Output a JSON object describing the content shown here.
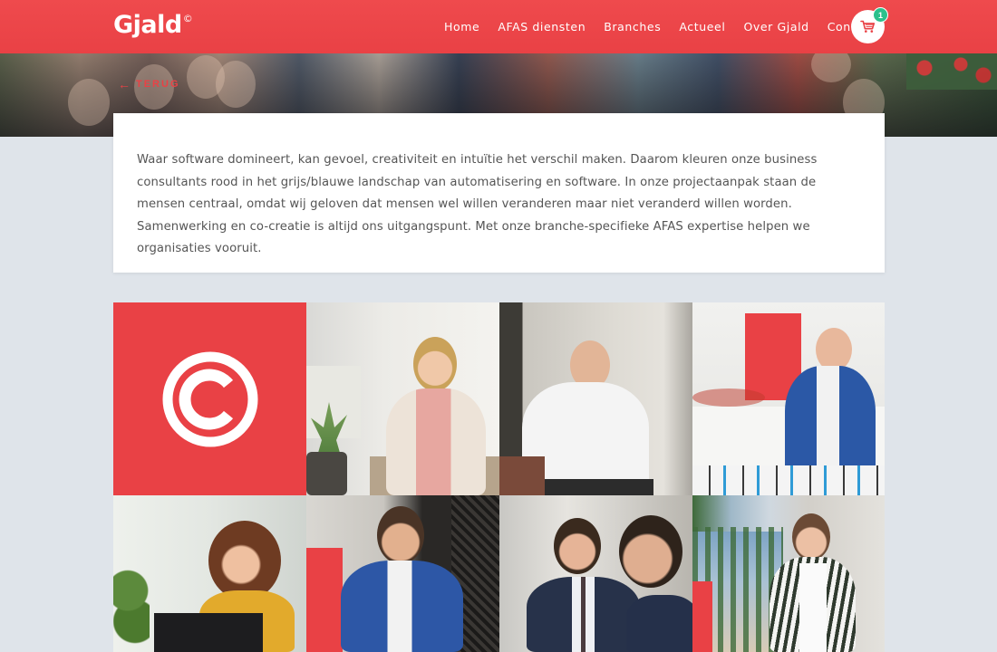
{
  "header": {
    "logo": "Gjald",
    "logo_mark": "©",
    "nav": [
      {
        "label": "Home"
      },
      {
        "label": "AFAS diensten"
      },
      {
        "label": "Branches"
      },
      {
        "label": "Actueel"
      },
      {
        "label": "Over Gjald"
      },
      {
        "label": "Contact"
      }
    ],
    "cart_count": "1",
    "cart_icon": "shopping-cart-icon"
  },
  "hero": {
    "back_label": "TERUG",
    "back_icon": "arrow-left-icon"
  },
  "intro": {
    "text": "Waar software domineert, kan gevoel, creativiteit en intuïtie het verschil maken. Daarom kleuren onze business consultants rood in het grijs/blauwe landschap van automatisering en software. In onze projectaanpak staan de mensen centraal, omdat wij geloven dat mensen wel willen veranderen maar niet veranderd willen worden.  Samenwerking en co-creatie is altijd ons uitgangspunt. Met onze branche-specifieke AFAS expertise helpen we organisaties vooruit."
  },
  "colors": {
    "brand_red": "#e94145",
    "badge_green": "#2cc08c",
    "page_bg": "#dfe4ea"
  }
}
